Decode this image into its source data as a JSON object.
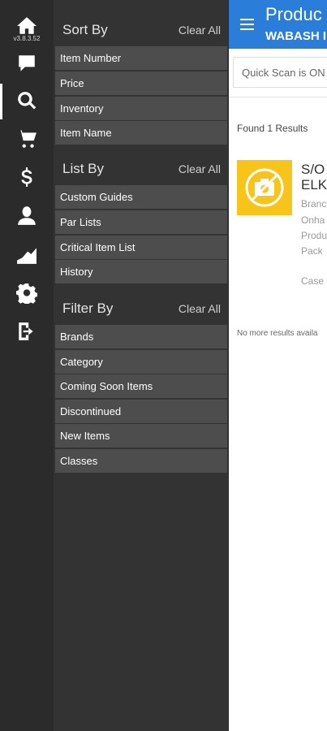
{
  "rail": {
    "version": "v3.8.3.52",
    "icons": [
      "home-icon",
      "chat-icon",
      "search-icon",
      "cart-icon",
      "dollar-icon",
      "user-icon",
      "chart-icon",
      "gear-icon",
      "logout-icon"
    ]
  },
  "sort_by": {
    "title": "Sort By",
    "clear": "Clear All",
    "options": [
      "Item Number",
      "Price",
      "Inventory",
      "Item Name"
    ]
  },
  "list_by": {
    "title": "List By",
    "clear": "Clear All",
    "options": [
      "Custom Guides",
      "Par Lists",
      "Critical Item List",
      "History"
    ]
  },
  "filter_by": {
    "title": "Filter By",
    "clear": "Clear All",
    "options": [
      "Brands",
      "Category",
      "Coming Soon Items",
      "Discontinued",
      "New Items",
      "Classes"
    ]
  },
  "header": {
    "title": "Produc",
    "subtitle": "WABASH I"
  },
  "search": {
    "placeholder": "Quick Scan is ON"
  },
  "results": {
    "found": "Found 1 Results",
    "product": {
      "line1": "S/O",
      "line2": "ELK",
      "brand": "Branc",
      "onhand": "Onha",
      "product": "Produ",
      "pack": "Pack",
      "case": "Case"
    },
    "end": "No more results availa"
  },
  "colors": {
    "accent": "#2a7dd8",
    "thumb": "#f8c419",
    "panel": "#333333",
    "option": "#4d4d4d"
  }
}
